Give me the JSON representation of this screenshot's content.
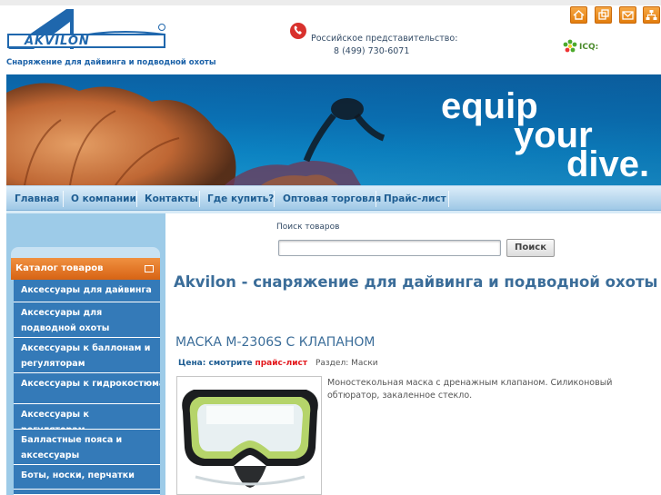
{
  "header": {
    "logo_text": "AKVILON",
    "tagline": "Снаряжение для дайвинга и подводной охоты",
    "phone_label": "Российское представительство:",
    "phone_number": "8 (499) 730-6071",
    "icq_label": "ICQ:",
    "top_icons": [
      "home-icon",
      "copy-icon",
      "mail-icon",
      "sitemap-icon"
    ]
  },
  "banner": {
    "line1": "equip",
    "line2": "your",
    "line3": "dive."
  },
  "nav": {
    "items": [
      "Главная",
      "О компании",
      "Контакты",
      "Где купить?",
      "Оптовая торговля",
      "Прайс-лист"
    ]
  },
  "sidebar": {
    "catalog_title": "Каталог товаров",
    "items": [
      "Аксессуары для дайвинга",
      "Аксессуары для подводной охоты",
      "Аксессуары к баллонам и регуляторам",
      "Аксессуары к гидрокостюмам",
      "Аксессуары к регуляторам",
      "Балластные пояса и аксессуары",
      "Боты, носки, перчатки"
    ]
  },
  "search": {
    "label": "Поиск товаров",
    "value": "",
    "button": "Поиск"
  },
  "main": {
    "page_title": "Akvilon - снаряжение для дайвинга и подводной охоты",
    "product_title": "МАСКА M-2306S С КЛАПАНОМ",
    "price_label": "Цена: смотрите",
    "price_link": "прайс-лист",
    "section_label": "Раздел: Маски",
    "description": "Моностекольная маска с дренажным клапаном. Силиконовый обтюратор, закаленное стекло."
  },
  "colors": {
    "accent_blue": "#1e5d92",
    "orange": "#e27d0d",
    "nav_bg": "#9ec8e6",
    "sidebar_bg": "#9dcbe8",
    "link_red": "#e3181d"
  }
}
